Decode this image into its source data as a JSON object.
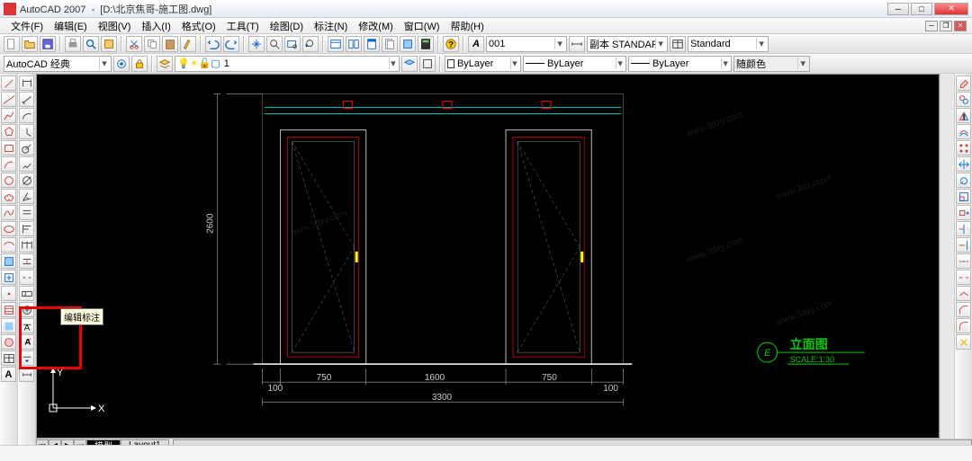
{
  "titlebar": {
    "app": "AutoCAD 2007",
    "doc": "[D:\\北京焦哥-施工图.dwg]"
  },
  "menu": {
    "file": "文件(F)",
    "edit": "编辑(E)",
    "view": "视图(V)",
    "insert": "插入(I)",
    "format": "格式(O)",
    "tools": "工具(T)",
    "draw": "绘图(D)",
    "dim": "标注(N)",
    "modify": "修改(M)",
    "window": "窗口(W)",
    "help": "帮助(H)"
  },
  "combos": {
    "style1": "001",
    "style2": "副本 STANDARI",
    "style3": "Standard",
    "workspace": "AutoCAD 经典",
    "layer": "1",
    "lt1": "ByLayer",
    "lt2": "ByLayer",
    "lt3": "ByLayer",
    "color": "随颜色"
  },
  "tabs": {
    "model": "模型",
    "layout1": "Layout1"
  },
  "tooltip": "编辑标注",
  "ucs": {
    "x": "X",
    "y": "Y"
  },
  "drawing": {
    "dims": {
      "h": "2600",
      "w1": "100",
      "w2": "750",
      "w3": "1600",
      "w4": "750",
      "w5": "100",
      "total": "3300"
    },
    "title": "立面图",
    "scale": "SCALE:1:30",
    "tag": "E"
  },
  "watermark": "www.3dxy.com"
}
